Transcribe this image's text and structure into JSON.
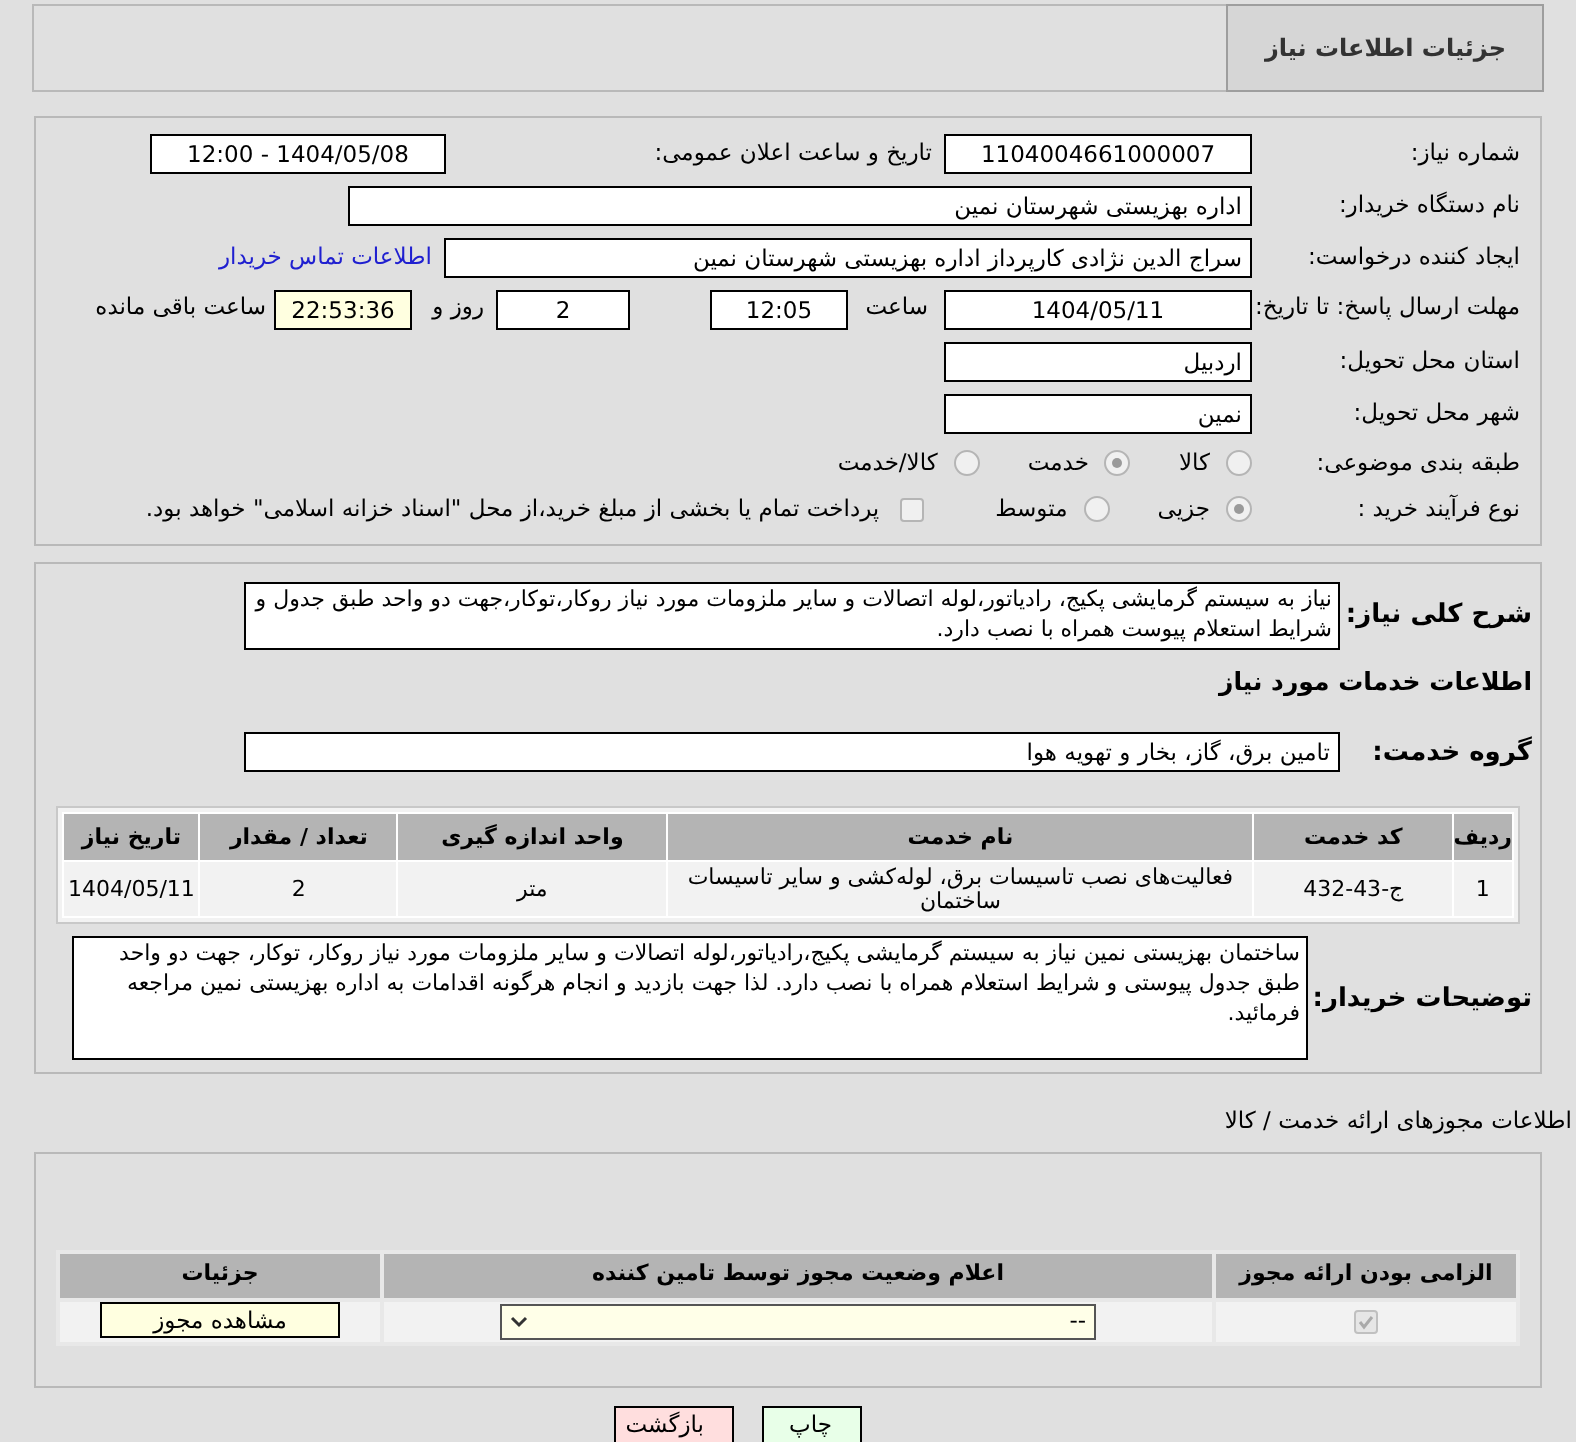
{
  "page_title": "جزئیات اطلاعات نیاز",
  "form": {
    "need_number": {
      "label": "شماره نیاز:",
      "value": "1104004661000007"
    },
    "announce": {
      "label": "تاریخ و ساعت اعلان عمومی:",
      "value": "1404/05/08 - 12:00"
    },
    "buyer": {
      "label": "نام دستگاه خریدار:",
      "value": "اداره بهزیستی شهرستان نمین"
    },
    "creator": {
      "label": "ایجاد کننده درخواست:",
      "value": "سراج الدین نژادی کارپرداز اداره بهزیستی شهرستان نمین",
      "link": "اطلاعات تماس خریدار"
    },
    "deadline": {
      "label": "مهلت ارسال پاسخ: تا تاریخ:",
      "date": "1404/05/11",
      "time_label": "ساعت",
      "time": "12:05",
      "days": "2",
      "days_label": "روز و",
      "remaining": "22:53:36",
      "remaining_label": "ساعت باقی مانده"
    },
    "province": {
      "label": "استان محل تحویل:",
      "value": "اردبیل"
    },
    "city": {
      "label": "شهر محل تحویل:",
      "value": "نمین"
    },
    "category": {
      "label": "طبقه بندی موضوعی:",
      "options": [
        {
          "label": "کالا",
          "selected": false
        },
        {
          "label": "خدمت",
          "selected": true
        },
        {
          "label": "کالا/خدمت",
          "selected": false
        }
      ]
    },
    "process": {
      "label": "نوع فرآیند خرید :",
      "options": [
        {
          "label": "جزیی",
          "selected": true
        },
        {
          "label": "متوسط",
          "selected": false
        }
      ],
      "payment": {
        "label": "پرداخت تمام یا بخشی از مبلغ خرید،از محل \"اسناد خزانه اسلامی\" خواهد بود.",
        "checked": false
      }
    }
  },
  "details": {
    "summary": {
      "label": "شرح کلی نیاز:",
      "value": "نیاز به سیستم گرمایشی پکیج، رادیاتور،لوله اتصالات و سایر ملزومات مورد نیاز روکار،توکار،جهت دو واحد طبق جدول و شرایط استعلام پیوست همراه با نصب دارد."
    },
    "services_heading": "اطلاعات خدمات مورد نیاز",
    "service_group": {
      "label": "گروه خدمت:",
      "value": "تامین برق، گاز، بخار و تهویه هوا"
    },
    "table": {
      "columns": [
        "ردیف",
        "کد خدمت",
        "نام خدمت",
        "واحد اندازه گیری",
        "تعداد / مقدار",
        "تاریخ نیاز"
      ],
      "rows": [
        [
          "1",
          "ج-43-432",
          "فعالیت‌های نصب تاسیسات برق، لوله‌کشی و سایر تاسیسات ساختمان",
          "متر",
          "2",
          "1404/05/11"
        ]
      ]
    },
    "buyer_notes": {
      "label": "توضیحات خریدار:",
      "value": "ساختمان بهزیستی نمین نیاز به سیستم گرمایشی پکیج،رادیاتور،لوله اتصالات و سایر ملزومات مورد نیاز روکار، توکار، جهت دو واحد طبق جدول پیوستی و شرایط استعلام همراه با نصب دارد. لذا جهت بازدید و انجام هرگونه اقدامات به اداره بهزیستی نمین مراجعه فرمائید."
    }
  },
  "licenses": {
    "heading": "اطلاعات مجوزهای ارائه خدمت / کالا",
    "columns": [
      "الزامی بودن ارائه مجوز",
      "اعلام وضعیت مجوز توسط تامین کننده",
      "جزئیات"
    ],
    "rows": [
      {
        "required": true,
        "status": "--",
        "action": "مشاهده مجوز"
      }
    ]
  },
  "buttons": [
    {
      "kind": "print",
      "label": "چاپ"
    },
    {
      "kind": "back",
      "label": "بازگشت"
    }
  ]
}
